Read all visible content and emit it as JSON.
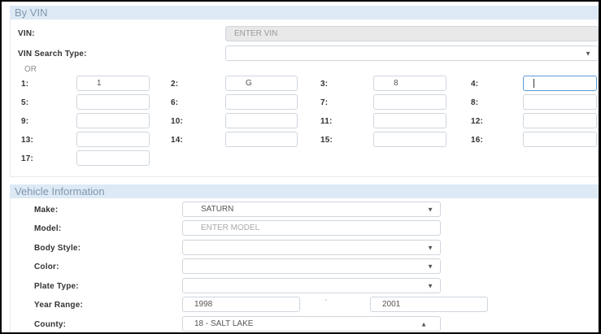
{
  "vin_section": {
    "title": "By VIN",
    "vin_label": "VIN:",
    "vin_placeholder": "ENTER VIN",
    "search_type_label": "VIN Search Type:",
    "search_type_value": "",
    "or_label": "OR",
    "positions": [
      {
        "label": "1:",
        "value": "1"
      },
      {
        "label": "2:",
        "value": "G"
      },
      {
        "label": "3:",
        "value": "8"
      },
      {
        "label": "4:",
        "value": ""
      },
      {
        "label": "5:",
        "value": ""
      },
      {
        "label": "6:",
        "value": ""
      },
      {
        "label": "7:",
        "value": ""
      },
      {
        "label": "8:",
        "value": ""
      },
      {
        "label": "9:",
        "value": ""
      },
      {
        "label": "10:",
        "value": ""
      },
      {
        "label": "11:",
        "value": ""
      },
      {
        "label": "12:",
        "value": ""
      },
      {
        "label": "13:",
        "value": ""
      },
      {
        "label": "14:",
        "value": ""
      },
      {
        "label": "15:",
        "value": ""
      },
      {
        "label": "16:",
        "value": ""
      },
      {
        "label": "17:",
        "value": ""
      }
    ]
  },
  "vehicle_section": {
    "title": "Vehicle Information",
    "make_label": "Make:",
    "make_value": "SATURN",
    "model_label": "Model:",
    "model_placeholder": "ENTER MODEL",
    "body_style_label": "Body Style:",
    "body_style_value": "",
    "color_label": "Color:",
    "color_value": "",
    "plate_type_label": "Plate Type:",
    "plate_type_value": "",
    "year_range_label": "Year Range:",
    "year_from": "1998",
    "year_separator": "-",
    "year_to": "2001",
    "county_label": "County:",
    "county_value": "18 - SALT LAKE"
  },
  "icons": {
    "dropdown": "caret-down-icon",
    "dropdown_open": "caret-up-icon"
  },
  "colors": {
    "header_bg": "#dde9f5",
    "header_text": "#7f97ad",
    "focus_border": "#5b9bd5"
  }
}
